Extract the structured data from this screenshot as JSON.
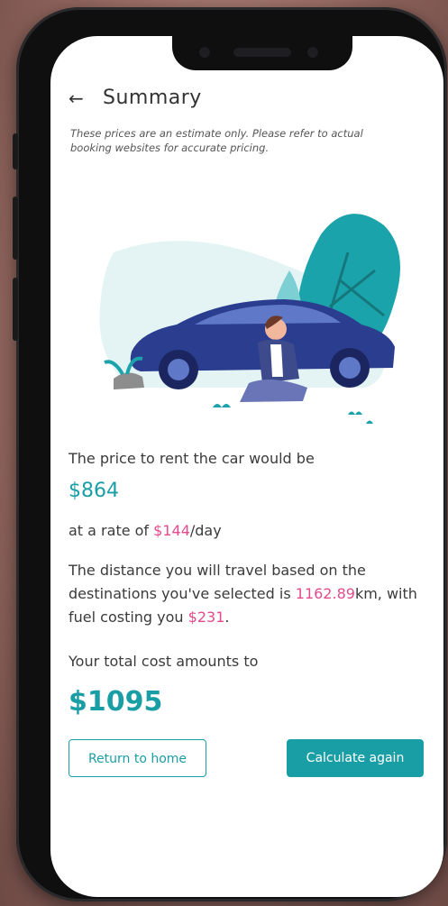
{
  "header": {
    "title": "Summary",
    "back_icon": "arrow-left-icon"
  },
  "disclaimer": "These prices are an estimate only. Please refer to actual booking websites for accurate pricing.",
  "rental": {
    "intro": "The price to rent the car would be",
    "price": "$864",
    "rate_prefix": "at a rate of ",
    "rate": "$144",
    "rate_suffix": "/day"
  },
  "distance": {
    "prefix": "The distance you will travel based on the destinations you've selected is ",
    "km": "1162.89",
    "km_unit": "km,",
    "fuel_prefix": " with fuel costing you ",
    "fuel": "$231",
    "fuel_suffix": "."
  },
  "total": {
    "label": "Your total cost amounts to",
    "value": "$1095"
  },
  "buttons": {
    "home": "Return to home",
    "again": "Calculate again"
  },
  "colors": {
    "accent": "#1a9ea5",
    "highlight": "#e24b8d"
  }
}
